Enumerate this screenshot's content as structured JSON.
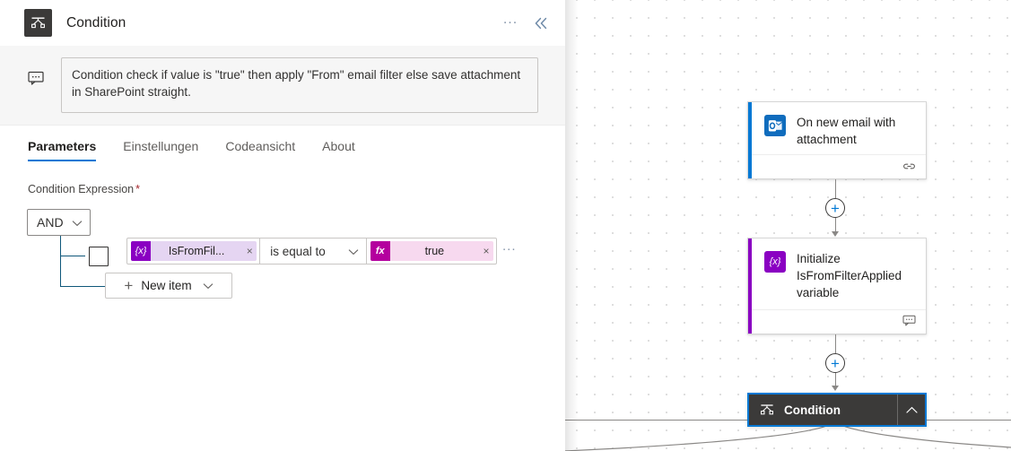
{
  "panel": {
    "header": {
      "icon": "condition-icon",
      "title": "Condition",
      "more_label": "...",
      "collapse_label": "«"
    },
    "description": {
      "icon": "comment-icon",
      "text": "Condition check if value is \"true\" then apply \"From\" email filter else save attachment in SharePoint straight."
    },
    "tabs": [
      {
        "label": "Parameters",
        "active": true
      },
      {
        "label": "Einstellungen",
        "active": false
      },
      {
        "label": "Codeansicht",
        "active": false
      },
      {
        "label": "About",
        "active": false
      }
    ],
    "condition_expression": {
      "label": "Condition Expression",
      "required_marker": "*",
      "logic_operator": {
        "value": "AND",
        "caret": "∨"
      },
      "rows": [
        {
          "checkbox_checked": false,
          "left_token": {
            "badge": "{x}",
            "text": "IsFromFil...",
            "remove": "×"
          },
          "operator": {
            "value": "is equal to",
            "caret": "∨"
          },
          "right_token": {
            "badge": "fx",
            "text": "true",
            "remove": "×"
          },
          "overflow_menu": "..."
        }
      ],
      "new_item_button": {
        "plus": "+",
        "label": "New item",
        "caret": "∨"
      }
    }
  },
  "canvas": {
    "nodes": [
      {
        "id": "trigger",
        "title": "On new email with attachment",
        "icon": "outlook-icon",
        "accent_color": "#0078d4",
        "footer_icon": "connection-link-icon"
      },
      {
        "id": "initialize-variable",
        "title": "Initialize IsFromFilterApplied variable",
        "icon": "variable-icon",
        "accent_color": "#8a00c2",
        "footer_icon": "comment-icon"
      }
    ],
    "add_buttons": [
      {
        "label": "+"
      },
      {
        "label": "+"
      }
    ],
    "selected_node": {
      "title": "Condition",
      "icon": "condition-icon",
      "collapse_icon": "chevron-up-icon",
      "selection_color": "#0078d4",
      "background_color": "#3b3a39"
    }
  }
}
